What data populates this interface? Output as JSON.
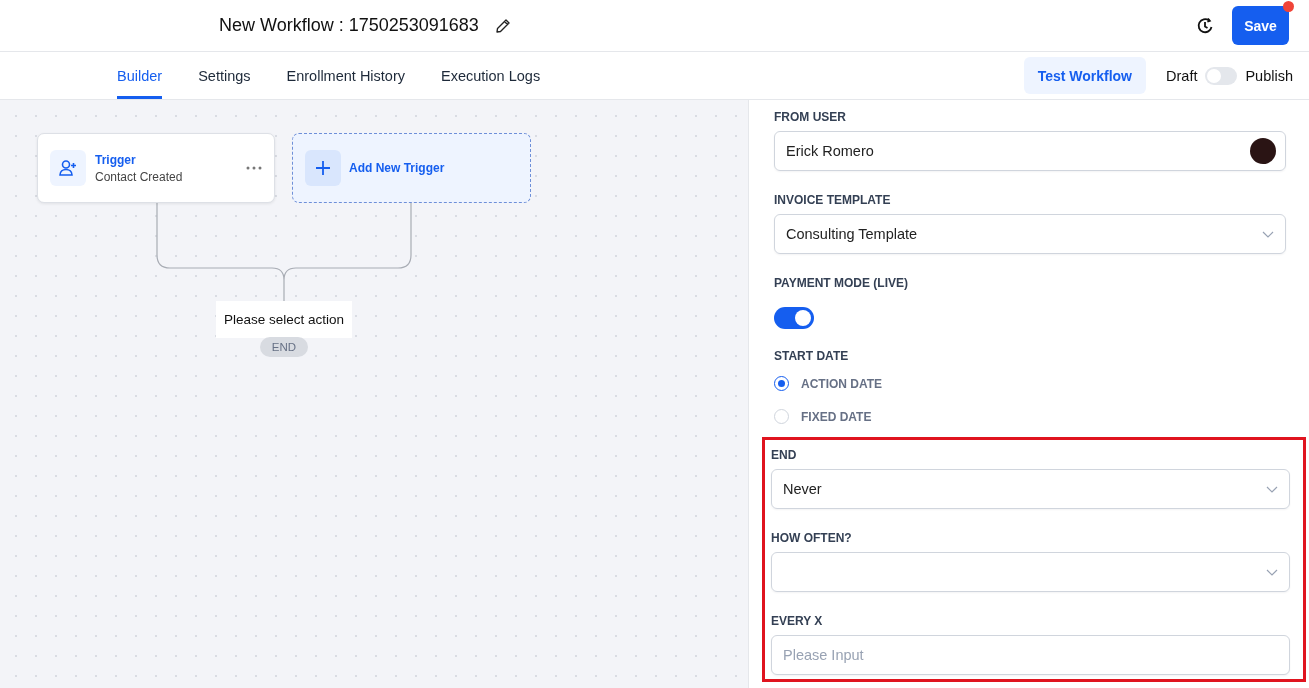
{
  "header": {
    "title": "New Workflow : 1750253091683",
    "save_label": "Save",
    "unsaved_changes": true
  },
  "tabs": [
    {
      "label": "Builder",
      "selected": true
    },
    {
      "label": "Settings",
      "selected": false
    },
    {
      "label": "Enrollment History",
      "selected": false
    },
    {
      "label": "Execution Logs",
      "selected": false
    }
  ],
  "test_button": "Test Workflow",
  "publish_toggle": {
    "off_label": "Draft",
    "on_label": "Publish",
    "on": false
  },
  "canvas": {
    "trigger": {
      "title": "Trigger",
      "subtitle": "Contact Created"
    },
    "add_trigger": "Add New Trigger",
    "action_placeholder": "Please select action",
    "end_label": "END"
  },
  "panel": {
    "fields": [
      {
        "kind": "user-select",
        "label": "FROM USER",
        "value": "Erick Romero"
      },
      {
        "kind": "select",
        "label": "INVOICE TEMPLATE",
        "value": "Consulting Template"
      },
      {
        "kind": "toggle",
        "label": "PAYMENT MODE (LIVE)",
        "on": true
      },
      {
        "kind": "radio",
        "label": "START DATE",
        "options": [
          {
            "label": "ACTION DATE",
            "selected": true
          },
          {
            "label": "FIXED DATE",
            "selected": false
          }
        ]
      }
    ],
    "highlighted_fields": [
      {
        "kind": "select",
        "label": "END",
        "value": "Never"
      },
      {
        "kind": "select",
        "label": "HOW OFTEN?"
      },
      {
        "kind": "input",
        "label": "EVERY X",
        "placeholder": "Please Input"
      }
    ]
  }
}
